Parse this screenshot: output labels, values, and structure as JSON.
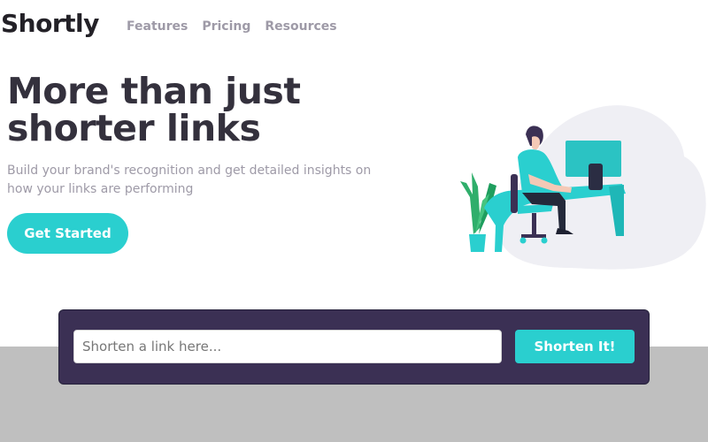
{
  "brand": {
    "logo_text": "Shortly"
  },
  "nav": {
    "items": [
      {
        "label": "Features"
      },
      {
        "label": "Pricing"
      },
      {
        "label": "Resources"
      }
    ]
  },
  "hero": {
    "headline_line1": "More than just",
    "headline_line2": "shorter links",
    "subtitle": "Build your brand's recognition and get detailed insights on how your links are performing",
    "cta_label": "Get Started",
    "illustration_icon": "person-working-at-desk-illustration"
  },
  "shorten": {
    "placeholder": "Shorten a link here...",
    "value": "",
    "button_label": "Shorten It!"
  },
  "colors": {
    "accent": "#2acfcf",
    "dark_violet": "#3b3054",
    "heading": "#34313d",
    "muted": "#9e9aa7",
    "band": "#bfbfbf"
  }
}
